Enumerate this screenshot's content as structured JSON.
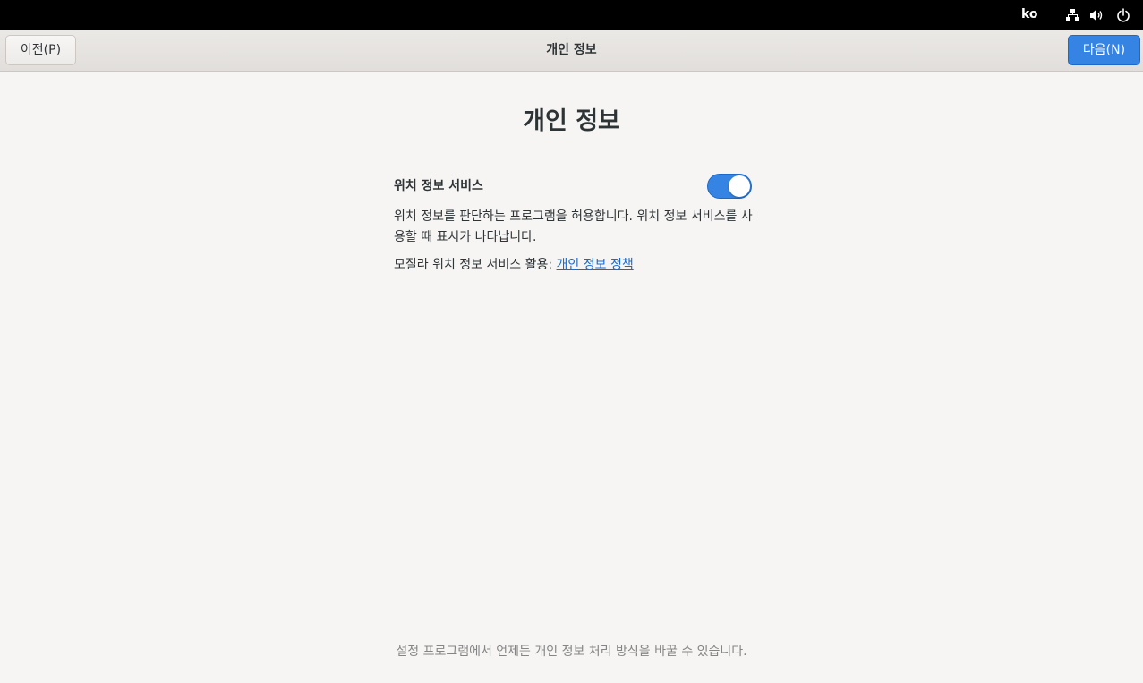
{
  "topbar": {
    "language": "ko",
    "icons": [
      "network-icon",
      "volume-icon",
      "power-icon"
    ]
  },
  "header": {
    "prev_label": "이전(P)",
    "title": "개인 정보",
    "next_label": "다음(N)"
  },
  "main": {
    "title": "개인 정보",
    "location": {
      "label": "위치 정보 서비스",
      "enabled": true,
      "description": "위치 정보를 판단하는 프로그램을 허용합니다. 위치 정보 서비스를 사용할 때 표시가 나타납니다.",
      "policy_prefix": "모질라 위치 정보 서비스 활용: ",
      "policy_link": "개인 정보 정책"
    },
    "footer_note": "설정 프로그램에서 언제든 개인 정보 처리 방식을 바꿀 수 있습니다."
  },
  "colors": {
    "accent": "#3584e4",
    "link": "#1b6acb",
    "topbar": "#000000",
    "background": "#f6f5f4"
  }
}
